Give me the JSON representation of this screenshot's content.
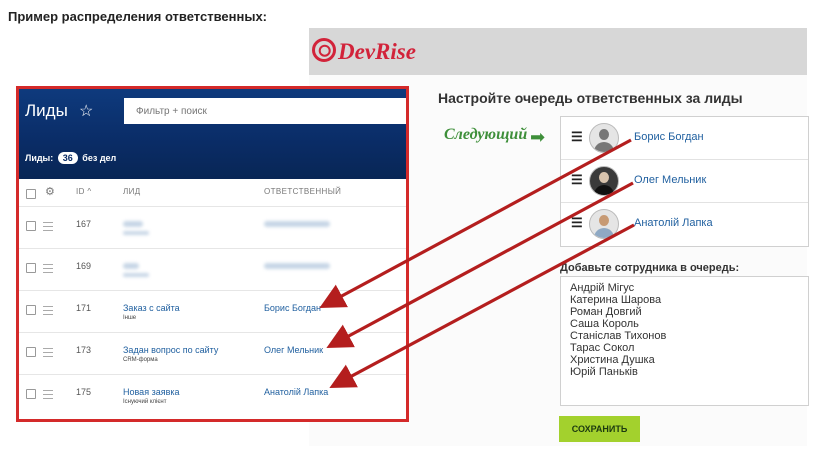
{
  "heading": "Пример распределения ответственных:",
  "logo": "DevRise",
  "queue_panel": {
    "title": "Настройте очередь ответственных за лиды",
    "next_label": "Следующий",
    "queue": [
      {
        "name": "Борис Богдан",
        "avatar": "user-placeholder-icon"
      },
      {
        "name": "Олег Мельник",
        "avatar": "user-photo-icon"
      },
      {
        "name": "Анатолій Лапка",
        "avatar": "user-avatar-icon"
      }
    ],
    "add_label": "Добавьте сотрудника в очередь:",
    "staff": [
      "Андрій Мігус",
      "Катерина Шарова",
      "Роман Довгий",
      "Саша Король",
      "Станіслав Тихонов",
      "Тарас Сокол",
      "Христина Душка",
      "Юрій Паньків"
    ],
    "save_label": "СОХРАНИТЬ"
  },
  "crm": {
    "title": "Лиды",
    "search_placeholder": "Фильтр + поиск",
    "count_prefix": "Лиды:",
    "count": "36",
    "count_suffix": "без дел",
    "columns": {
      "id": "ID ^",
      "lead": "лид",
      "responsible": "ответственный"
    },
    "rows": [
      {
        "id": "167",
        "name": "",
        "source": "",
        "responsible": ""
      },
      {
        "id": "169",
        "name": "",
        "source": "",
        "responsible": ""
      },
      {
        "id": "171",
        "name": "Заказ с сайта",
        "source": "Інше",
        "responsible": "Борис Богдан"
      },
      {
        "id": "173",
        "name": "Задан вопрос по сайту",
        "source": "CRM-форма",
        "responsible": "Олег Мельник"
      },
      {
        "id": "175",
        "name": "Новая заявка",
        "source": "Існуючий клієнт",
        "responsible": "Анатолій Лапка"
      }
    ]
  },
  "colors": {
    "frame": "#d42a2a",
    "arrow": "#b41e1e",
    "header": "#0a2c66",
    "save": "#a3d12d",
    "next": "#3e8f3a"
  }
}
